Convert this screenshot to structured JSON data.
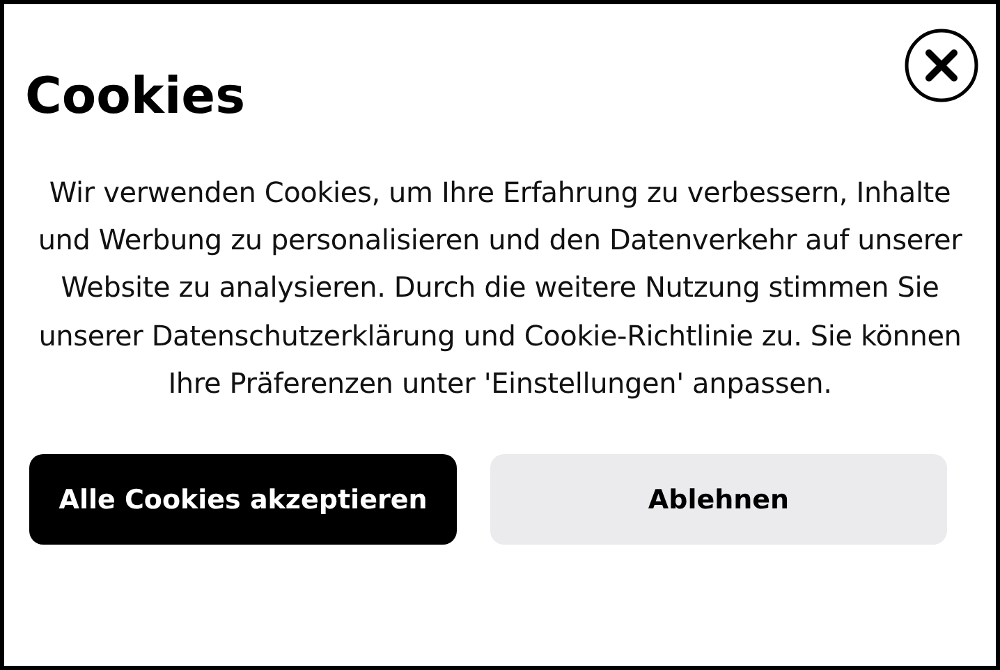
{
  "dialog": {
    "title": "Cookies",
    "message": "Wir verwenden Cookies, um Ihre Erfahrung zu verbessern, Inhalte und Werbung zu personalisieren und den Datenverkehr auf unserer Website zu analysieren. Durch die weitere Nutzung stimmen Sie unserer Datenschutzerklärung und Cookie-Richtlinie zu. Sie können Ihre Präferenzen unter 'Einstellungen' anpassen.",
    "buttons": [
      {
        "label": "Alle Cookies akzeptieren",
        "kind": "primary"
      },
      {
        "label": "Ablehnen",
        "kind": "secondary"
      }
    ]
  }
}
